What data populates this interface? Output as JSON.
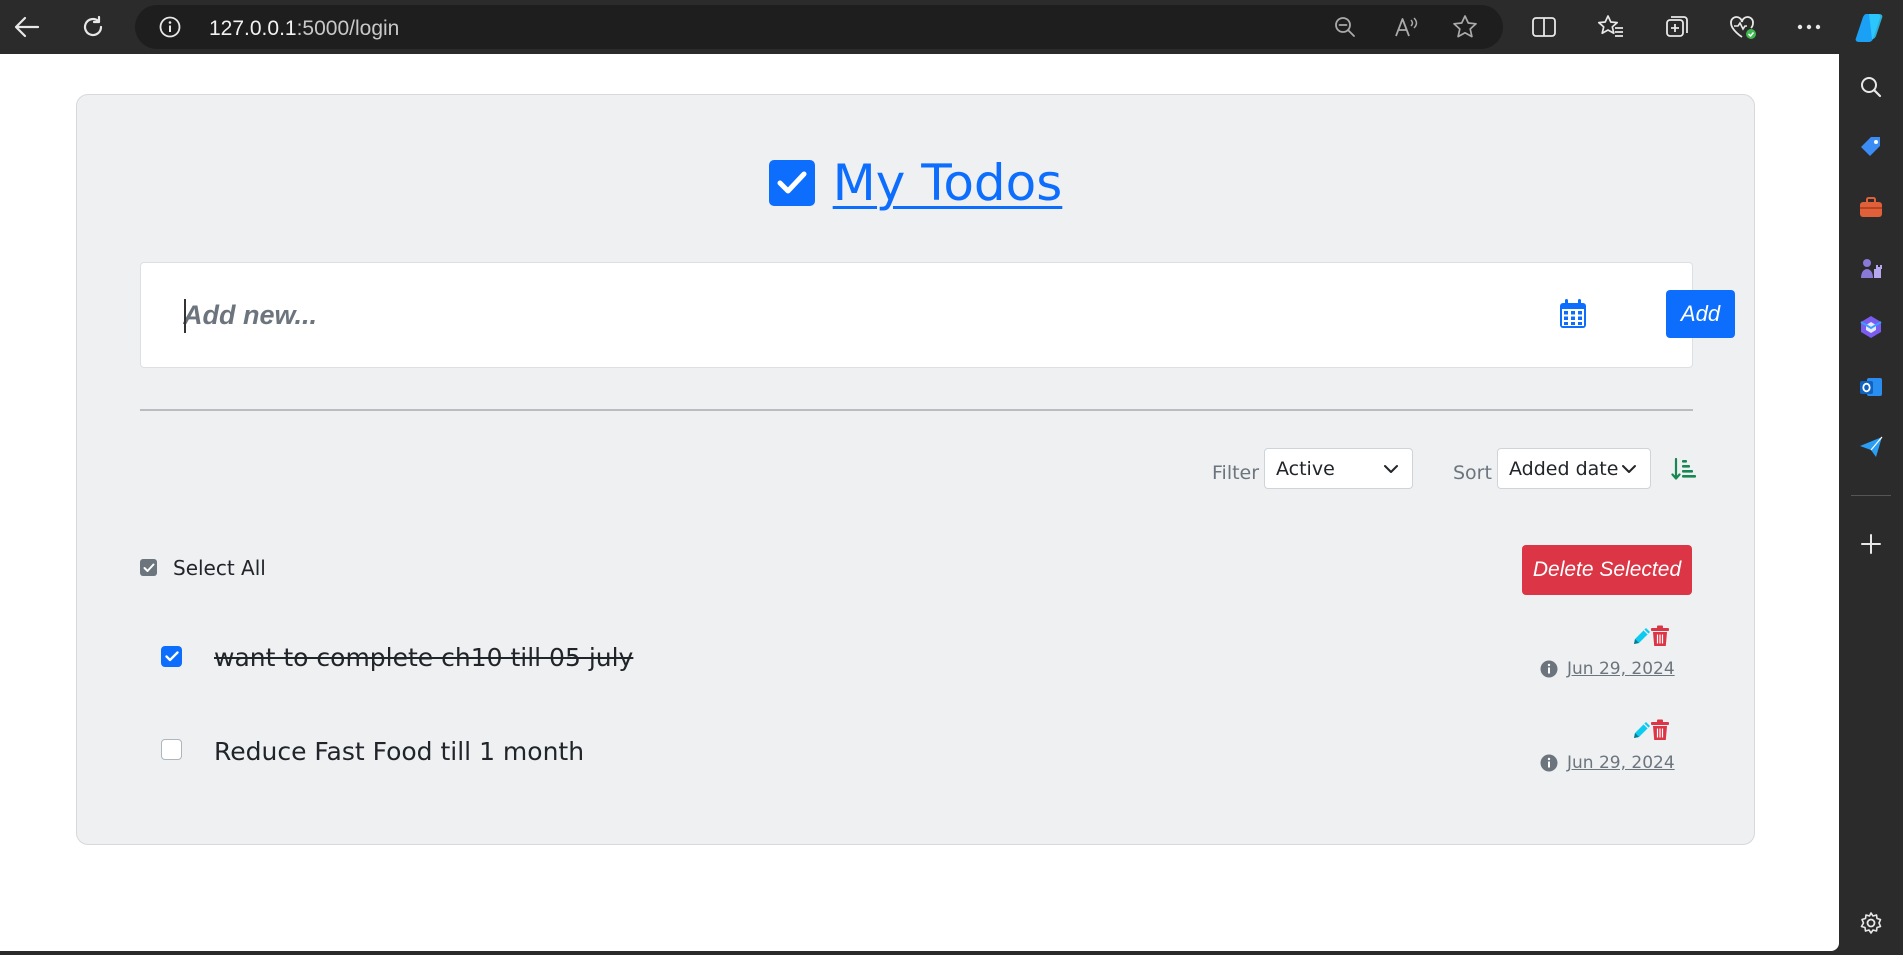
{
  "browser": {
    "url_host": "127.0.0.1",
    "url_rest": ":5000/login"
  },
  "page": {
    "title": "My Todos",
    "add_placeholder": "Add new...",
    "add_button": "Add",
    "filter_label": "Filter",
    "filter_value": "Active",
    "sort_label": "Sort",
    "sort_value": "Added date",
    "select_all_label": "Select All",
    "select_all_checked": true,
    "delete_selected_label": "Delete Selected"
  },
  "todos": [
    {
      "text": "want to complete ch10 till 05 july",
      "completed": true,
      "date": "Jun 29, 2024"
    },
    {
      "text": "Reduce Fast Food till 1 month",
      "completed": false,
      "date": "Jun 29, 2024"
    }
  ],
  "colors": {
    "primary": "#0d6efd",
    "danger": "#dc3545",
    "success": "#198754",
    "card_bg": "#eef0f2"
  }
}
